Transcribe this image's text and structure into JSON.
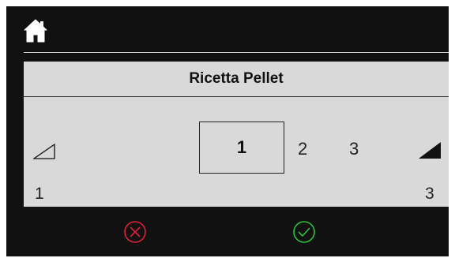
{
  "header": {
    "home_icon": "home-icon"
  },
  "panel": {
    "title": "Ricetta Pellet",
    "selected": "1",
    "options": [
      "2",
      "3"
    ],
    "range_min": "1",
    "range_max": "3",
    "decrease_icon": "ramp-low-icon",
    "increase_icon": "ramp-high-icon"
  },
  "actions": {
    "cancel_icon": "cancel-x-icon",
    "confirm_icon": "confirm-check-icon"
  },
  "colors": {
    "background": "#111111",
    "panel": "#d9d9d9",
    "cancel": "#e0203a",
    "confirm": "#2fc23a"
  }
}
